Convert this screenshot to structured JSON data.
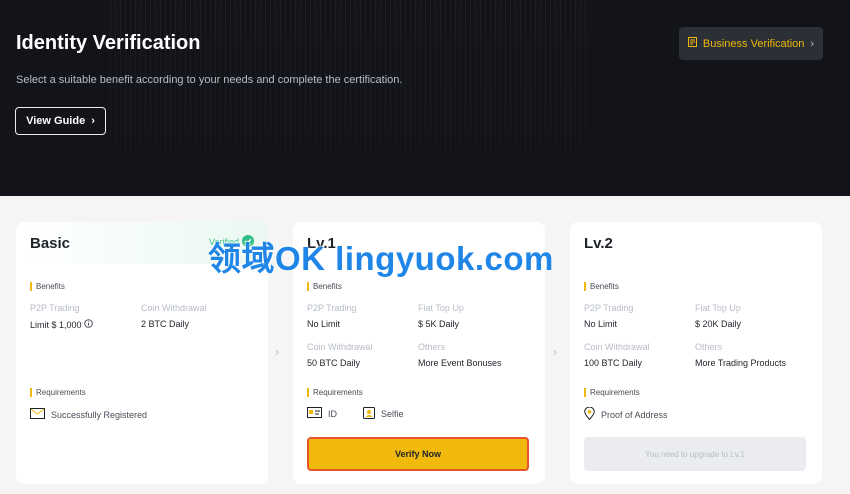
{
  "hero": {
    "title": "Identity Verification",
    "subtitle": "Select a suitable benefit according to your needs and complete the certification.",
    "guide_button": "View Guide",
    "business_button": "Business Verification"
  },
  "labels": {
    "benefits": "Benefits",
    "requirements": "Requirements"
  },
  "basic": {
    "title": "Basic",
    "status": "Verified",
    "p2p_label": "P2P Trading",
    "p2p_value": "Limit $ 1,000",
    "coin_label": "Coin Withdrawal",
    "coin_value": "2 BTC Daily",
    "requirement": "Successfully Registered"
  },
  "lv1": {
    "title": "Lv.1",
    "p2p_label": "P2P Trading",
    "p2p_value": "No Limit",
    "fiat_label": "Fiat Top Up",
    "fiat_value": "$ 5K Daily",
    "coin_label": "Coin Withdrawal",
    "coin_value": "50 BTC Daily",
    "others_label": "Others",
    "others_value": "More Event Bonuses",
    "req_id": "ID",
    "req_selfie": "Selfie",
    "button": "Verify Now"
  },
  "lv2": {
    "title": "Lv.2",
    "p2p_label": "P2P Trading",
    "p2p_value": "No Limit",
    "fiat_label": "Fiat Top Up",
    "fiat_value": "$ 20K Daily",
    "coin_label": "Coin Withdrawal",
    "coin_value": "100 BTC Daily",
    "others_label": "Others",
    "others_value": "More Trading Products",
    "requirement": "Proof of Address",
    "button": "You need to upgrade to Lv.1"
  },
  "watermark": "领域OK lingyuok.com",
  "colors": {
    "brand": "#f0b90b",
    "verified": "#2ebd85",
    "highlight_border": "#e8542b",
    "hero_bg": "#13141a"
  },
  "icons": [
    "chevron-right-icon",
    "document-icon",
    "check-circle-icon",
    "info-icon",
    "mail-icon",
    "id-card-icon",
    "selfie-icon",
    "location-pin-icon"
  ]
}
